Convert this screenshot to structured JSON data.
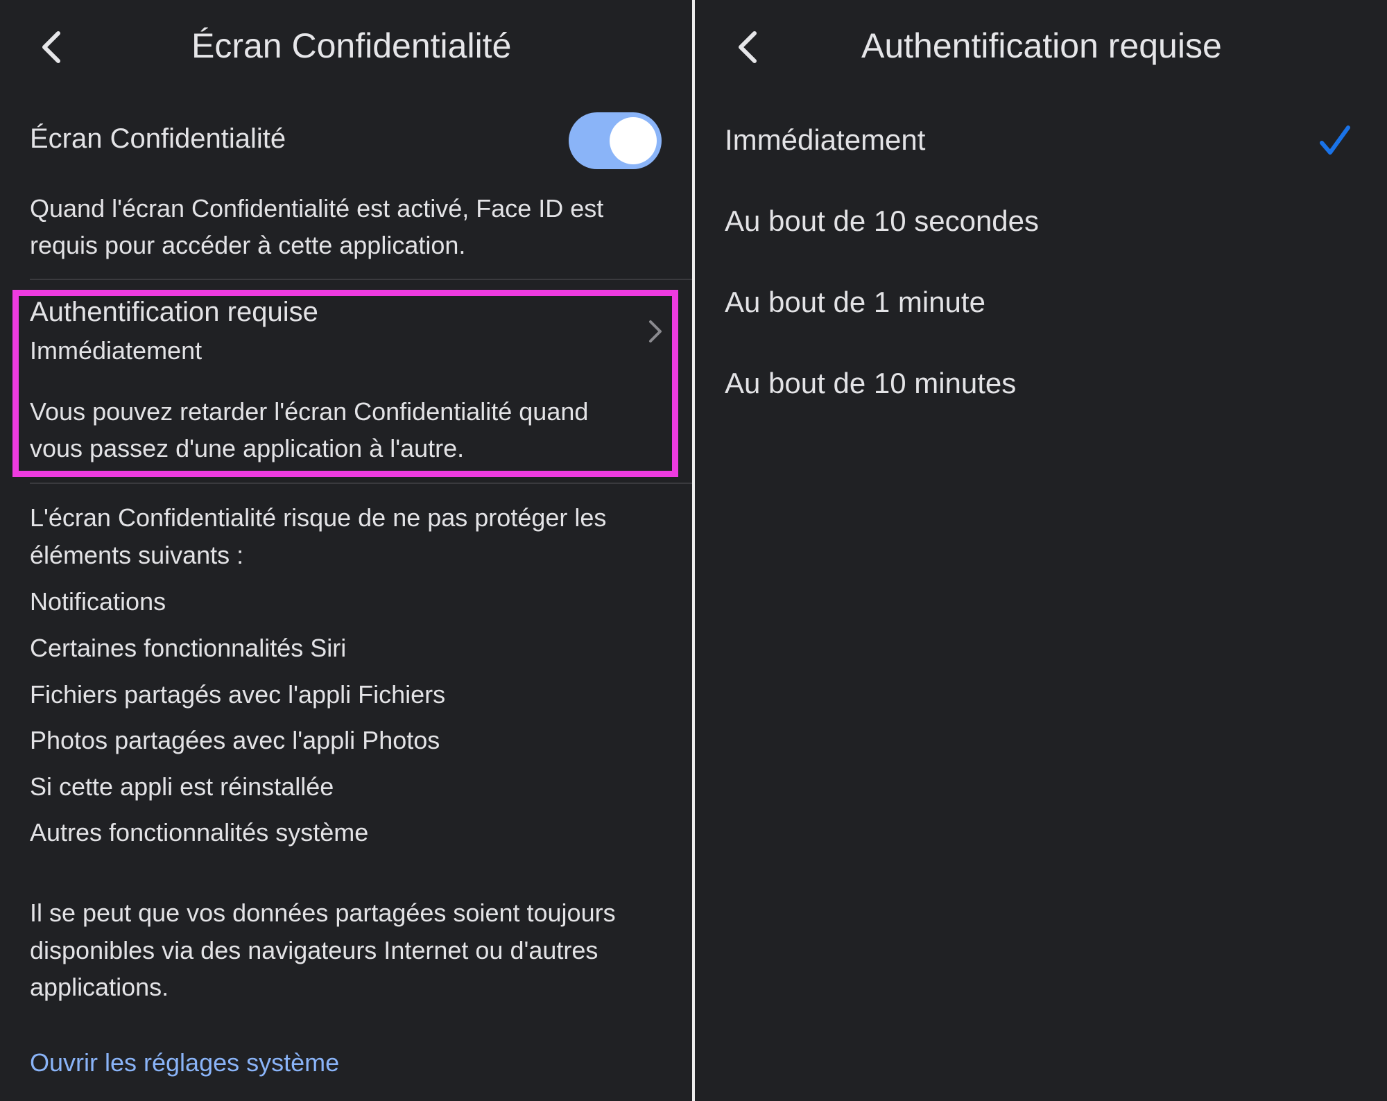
{
  "left": {
    "nav_title": "Écran Confidentialité",
    "back_icon": "chevron-left-icon",
    "toggle": {
      "label": "Écran Confidentialité",
      "state": "on",
      "track_color": "#8ab4f8"
    },
    "toggle_description": [
      "Quand l'écran Confidentialité est activé, Face ID est",
      "requis pour accéder à cette application."
    ],
    "auth_row": {
      "title": "Authentification requise",
      "value": "Immédiatement",
      "icon": "chevron-right-icon"
    },
    "auth_description": [
      "Vous pouvez retarder l'écran Confidentialité quand",
      "vous passez d'une application à l'autre."
    ],
    "risk_intro": [
      "L'écran Confidentialité risque de ne pas protéger les",
      "éléments suivants :"
    ],
    "risk_items": [
      "Notifications",
      "Certaines fonctionnalités Siri",
      "Fichiers partagés avec l'appli Fichiers",
      "Photos partagées avec l'appli Photos",
      "Si cette appli est réinstallée",
      "Autres fonctionnalités système"
    ],
    "shared_note": [
      "Il se peut que vos données partagées soient toujours",
      "disponibles via des navigateurs Internet ou d'autres",
      "applications."
    ],
    "system_settings_link": "Ouvrir les réglages système",
    "highlight_color": "#ee3be0",
    "link_color": "#8ab4f8"
  },
  "right": {
    "nav_title": "Authentification requise",
    "back_icon": "chevron-left-icon",
    "options": [
      "Immédiatement",
      "Au bout de 10 secondes",
      "Au bout de 1 minute",
      "Au bout de 10 minutes"
    ],
    "selected_index": 0,
    "check_icon": "checkmark-icon",
    "check_color": "#1a73e8"
  }
}
